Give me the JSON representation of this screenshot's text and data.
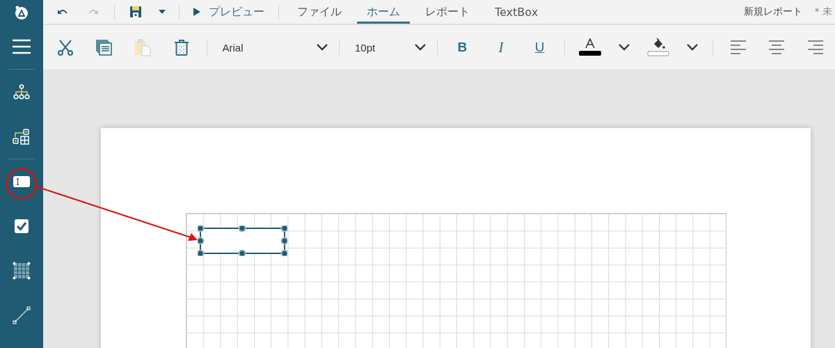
{
  "quick_access": [
    {
      "kind": "undo",
      "disabled": false
    },
    {
      "kind": "redo",
      "disabled": true
    },
    {
      "kind": "save",
      "disabled": false
    },
    {
      "kind": "save-menu",
      "disabled": false
    }
  ],
  "preview": {
    "label": "プレビュー"
  },
  "tabs": [
    {
      "label": "ファイル",
      "selected": false
    },
    {
      "label": "ホーム",
      "selected": true
    },
    {
      "label": "レポート",
      "selected": false
    },
    {
      "label": "TextBox",
      "selected": false
    }
  ],
  "document_title": "新規レポート",
  "save_status": "* 未",
  "toolbar": {
    "edit_buttons": [
      {
        "kind": "cut",
        "disabled": false
      },
      {
        "kind": "copy",
        "disabled": false
      },
      {
        "kind": "paste",
        "disabled": true
      },
      {
        "kind": "delete",
        "disabled": false
      }
    ],
    "font": "Arial",
    "font_size": "10pt",
    "format_buttons": [
      {
        "label": "B",
        "kind": "bold"
      },
      {
        "label": "I",
        "kind": "italic"
      },
      {
        "label": "U",
        "kind": "underline"
      }
    ],
    "align_buttons": [
      {
        "kind": "left"
      },
      {
        "kind": "center"
      },
      {
        "kind": "right"
      }
    ]
  },
  "sidebar": [
    {
      "kind": "menu"
    },
    {
      "kind": "tree"
    },
    {
      "kind": "components"
    },
    {
      "kind": "textbox"
    },
    {
      "kind": "checkbox"
    },
    {
      "kind": "table"
    },
    {
      "kind": "line"
    }
  ],
  "design_items": [
    {
      "kind": "textbox",
      "selected": true
    }
  ]
}
